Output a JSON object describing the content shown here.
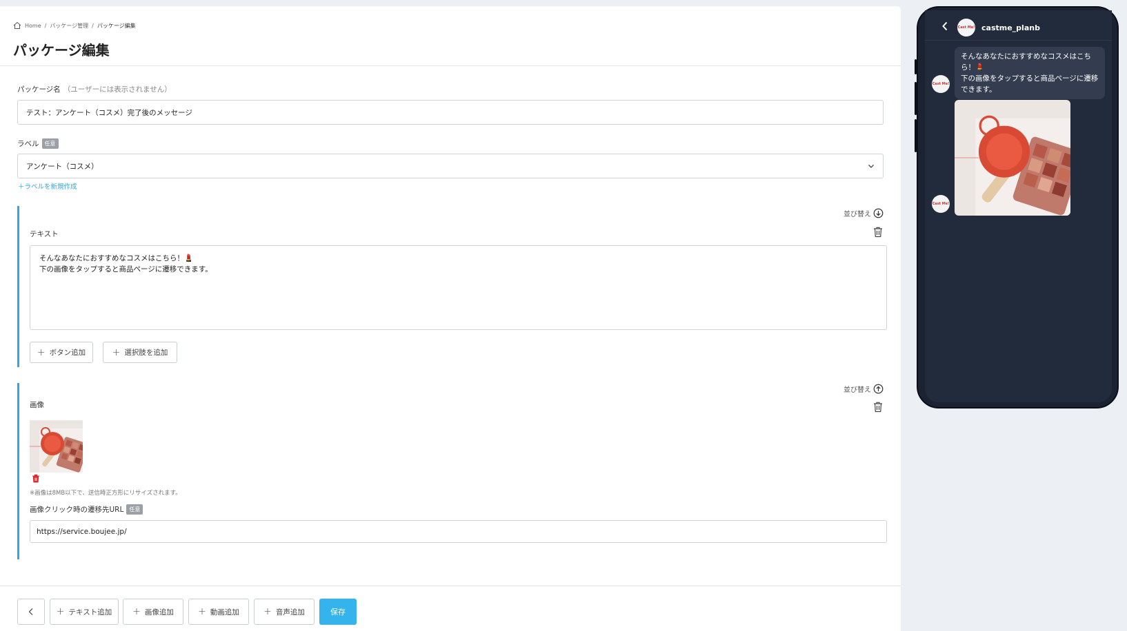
{
  "breadcrumb": {
    "items": [
      "Home",
      "パッケージ管理",
      "パッケージ編集"
    ],
    "separator": "/"
  },
  "page_title": "パッケージ編集",
  "package_name": {
    "label": "パッケージ名",
    "sublabel": "（ユーザーには表示されません）",
    "value": "テスト：アンケート（コスメ）完了後のメッセージ"
  },
  "label_field": {
    "label": "ラベル",
    "badge": "任意",
    "selected": "アンケート（コスメ）",
    "create_link": "＋ラベルを新規作成"
  },
  "text_block": {
    "sort_label": "並び替え",
    "title": "テキスト",
    "content": "そんなあなたにおすすめなコスメはこちら！💄\n下の画像をタップすると商品ページに遷移できます。",
    "add_button_label": "ボタン追加",
    "add_choice_label": "選択肢を追加"
  },
  "image_block": {
    "sort_label": "並び替え",
    "title": "画像",
    "note": "※画像は8MB以下で、送信時正方形にリサイズされます。",
    "url_label": "画像クリック時の遷移先URL",
    "url_badge": "任意",
    "url_value": "https://service.boujee.jp/"
  },
  "footer": {
    "add_text": "テキスト追加",
    "add_image": "画像追加",
    "add_video": "動画追加",
    "add_audio": "音声追加",
    "save": "保存"
  },
  "preview": {
    "account_name": "castme_planb",
    "avatar_text": "Cast Me!",
    "message": "そんなあなたにおすすめなコスメはこちら！💄\n下の画像をタップすると商品ページに遷移できます。"
  },
  "colors": {
    "accent": "#29abe2",
    "save_button": "#35b3ec",
    "phone_bg": "#222b3c",
    "bubble": "#333d4f",
    "delete_red": "#d32f2f"
  }
}
